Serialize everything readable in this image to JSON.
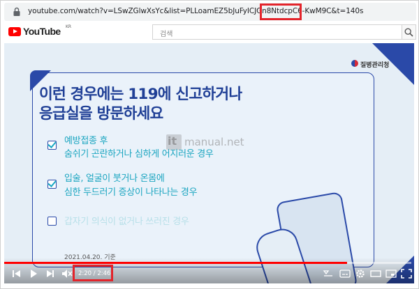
{
  "browser": {
    "url_main": "youtube.com/watch?v=LSwZGlwXsYc&list=PLLoamEZ5bJuFyICJGn8NtdcpC6-KwM9",
    "url_tail": "C&t=140s"
  },
  "header": {
    "logo_text": "YouTube",
    "logo_region": "KR",
    "search_placeholder": "검색"
  },
  "video": {
    "org_name": "질병관리청",
    "title_line1": "이런 경우에는 119에 신고하거나",
    "title_line2": "응급실을 방문하세요",
    "items": [
      {
        "line1": "예방접종 후",
        "line2": "숨쉬기 곤란하거나 심하게 어지러운 경우",
        "checked": true
      },
      {
        "line1": "입술, 얼굴이 붓거나 온몸에",
        "line2": "심한 두드러기 증상이 나타나는 경우",
        "checked": true
      },
      {
        "line1": "갑자기 의식이 없거나 쓰러진 경우",
        "line2": "",
        "checked": false
      }
    ],
    "date_note": "2021.04.20. 기준",
    "watermark_logo": "it",
    "watermark_text": "manual.net"
  },
  "player": {
    "current_time": "2:20",
    "duration": "2:46",
    "time_display": "2:20 / 2:46",
    "progress": 0.843,
    "accent_color": "#ff0000"
  },
  "colors": {
    "highlight_box": "#e3242b",
    "title_blue": "#1f3f96",
    "item_teal": "#1aa5c0"
  }
}
